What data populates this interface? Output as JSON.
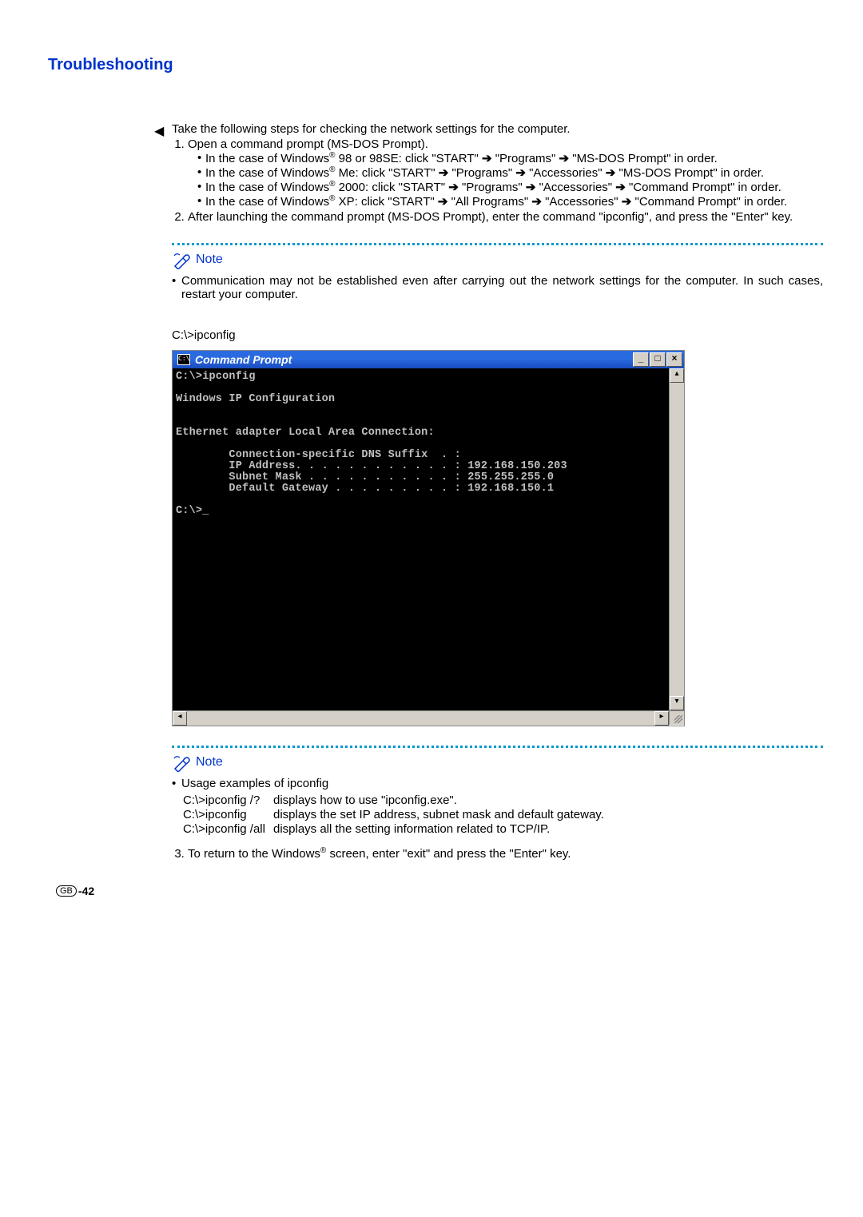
{
  "title": "Troubleshooting",
  "intro": "Take the following steps for checking the network settings for the computer.",
  "step1": "Open a command prompt (MS-DOS Prompt).",
  "b1a": "In the case of Windows",
  "b1b": " 98 or 98SE: click \"START\" ",
  "b1c": " \"Programs\" ",
  "b1d": " \"MS-DOS Prompt\" in order.",
  "b2a": "In the case of Windows",
  "b2b": " Me: click \"START\" ",
  "b2c": " \"Programs\" ",
  "b2d": " \"Accessories\" ",
  "b2e": " \"MS-DOS Prompt\" in order.",
  "b3a": "In the case of Windows",
  "b3b": " 2000: click \"START\" ",
  "b3c": " \"Programs\" ",
  "b3d": " \"Accessories\" ",
  "b3e": " \"Command Prompt\" in order.",
  "b4a": "In the case of Windows",
  "b4b": " XP: click \"START\" ",
  "b4c": " \"All Programs\" ",
  "b4d": " \"Accessories\" ",
  "b4e": " \"Command Prompt\" in order.",
  "step2": "After launching the command prompt (MS-DOS Prompt), enter the command \"ipconfig\", and press the \"Enter\" key.",
  "note_label": "Note",
  "note1": "Communication may not be established even after carrying out the network settings for the computer. In such cases, restart your computer.",
  "prompt_label": "C:\\>ipconfig",
  "cmd_title_icon": "C:\\",
  "cmd_title": "Command Prompt",
  "btn_min": "_",
  "btn_max": "□",
  "btn_close": "×",
  "scroll_up": "▴",
  "scroll_down": "▾",
  "scroll_left": "◂",
  "scroll_right": "▸",
  "cmd_body": "C:\\>ipconfig\n\nWindows IP Configuration\n\n\nEthernet adapter Local Area Connection:\n\n        Connection-specific DNS Suffix  . :\n        IP Address. . . . . . . . . . . . : 192.168.150.203\n        Subnet Mask . . . . . . . . . . . : 255.255.255.0\n        Default Gateway . . . . . . . . . : 192.168.150.1\n\nC:\\>_",
  "note2_title": "Usage examples of ipconfig",
  "usage": [
    {
      "cmd": "C:\\>ipconfig /?",
      "desc": "displays how to use \"ipconfig.exe\"."
    },
    {
      "cmd": "C:\\>ipconfig",
      "desc": "displays the set IP address, subnet mask and default gateway."
    },
    {
      "cmd": "C:\\>ipconfig /all",
      "desc": "displays all the setting information related to TCP/IP."
    }
  ],
  "step3a": "To return to the Windows",
  "step3b": " screen, enter \"exit\" and press the \"Enter\" key.",
  "reg": "®",
  "arrow": "➔",
  "footer_gb": "GB",
  "footer_page": "-42"
}
